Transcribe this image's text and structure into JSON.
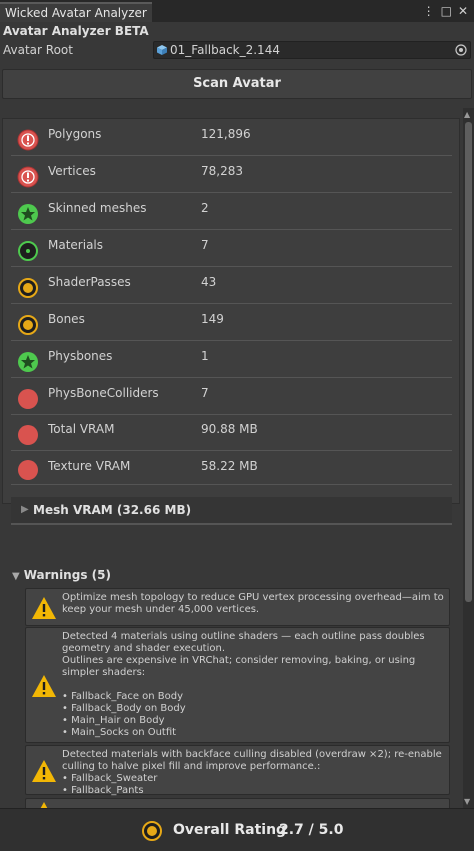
{
  "window": {
    "tab_title": "Wicked Avatar Analyzer"
  },
  "header": {
    "title": "Avatar Analyzer BETA",
    "root_label": "Avatar Root",
    "root_value": "01_Fallback_2.144"
  },
  "scan_button": "Scan Avatar",
  "stats": [
    {
      "name": "Polygons",
      "value": "121,896",
      "status": "error",
      "icon": "exclamation-icon"
    },
    {
      "name": "Vertices",
      "value": "78,283",
      "status": "error",
      "icon": "exclamation-icon"
    },
    {
      "name": "Skinned meshes",
      "value": "2",
      "status": "excellent",
      "icon": "star-icon"
    },
    {
      "name": "Materials",
      "value": "7",
      "status": "good",
      "icon": "dot-icon"
    },
    {
      "name": "ShaderPasses",
      "value": "43",
      "status": "medium",
      "icon": "dot-icon"
    },
    {
      "name": "Bones",
      "value": "149",
      "status": "medium",
      "icon": "dot-icon"
    },
    {
      "name": "Physbones",
      "value": "1",
      "status": "excellent",
      "icon": "star-icon"
    },
    {
      "name": "PhysBoneColliders",
      "value": "7",
      "status": "poor",
      "icon": "circle-icon"
    },
    {
      "name": "Total VRAM",
      "value": "90.88 MB",
      "status": "poor",
      "icon": "circle-icon"
    },
    {
      "name": "Texture VRAM",
      "value": "58.22 MB",
      "status": "poor",
      "icon": "circle-icon"
    }
  ],
  "mesh_vram_label": "Mesh VRAM (32.66 MB)",
  "warnings": {
    "header": "Warnings (5)",
    "items": [
      {
        "text": "Optimize mesh topology to reduce GPU vertex processing overhead—aim to keep your mesh under 45,000 vertices."
      },
      {
        "text": "Detected 4 materials using outline shaders — each outline pass doubles geometry and shader execution.\nOutlines are expensive in VRChat; consider removing, baking, or using simpler shaders:\n\n• Fallback_Face on Body\n• Fallback_Body on Body\n• Main_Hair on Body\n• Main_Socks on Outfit"
      },
      {
        "text": "Detected materials with backface culling disabled (overdraw ×2); re-enable culling to halve pixel fill and improve performance.:\n• Fallback_Sweater\n• Fallback_Pants"
      }
    ]
  },
  "footer": {
    "label": "Overall Rating",
    "value": "2.7 / 5.0"
  },
  "colors": {
    "error": "#d9534f",
    "poor": "#d9534f",
    "medium": "#e6a817",
    "good": "#4ec94e",
    "excellent": "#4ec94e",
    "warning": "#f2b705"
  }
}
